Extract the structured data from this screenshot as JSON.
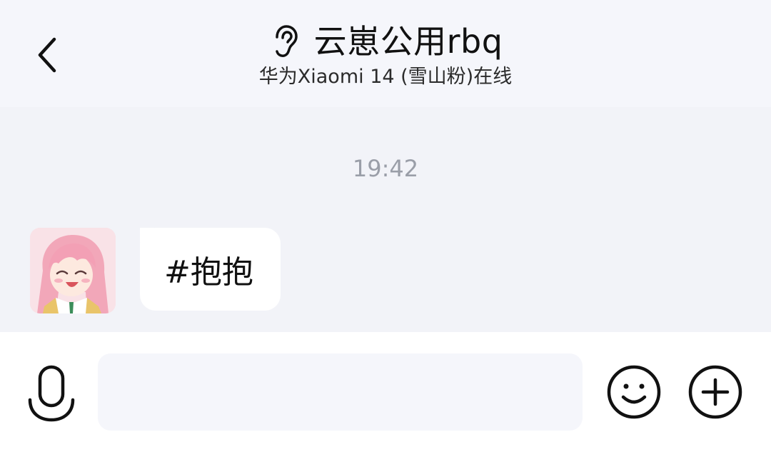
{
  "header": {
    "title": "云崽公用rbq",
    "subtitle": "华为Xiaomi 14 (雪山粉)在线",
    "back_icon": "chevron-left-icon",
    "mode_icon": "ear-icon"
  },
  "chat": {
    "timestamp": "19:42",
    "messages": [
      {
        "sender": "other",
        "text": "#抱抱",
        "avatar": "anime-girl-avatar"
      }
    ]
  },
  "input_bar": {
    "voice_icon": "microphone-icon",
    "input_value": "",
    "input_placeholder": "",
    "emoji_icon": "smiley-icon",
    "more_icon": "plus-circle-icon"
  },
  "colors": {
    "header_bg": "#f5f6fb",
    "chat_bg": "#f2f3f8",
    "bubble_bg": "#ffffff",
    "timestamp": "#9a9ea8",
    "input_bg": "#f5f6fb"
  }
}
